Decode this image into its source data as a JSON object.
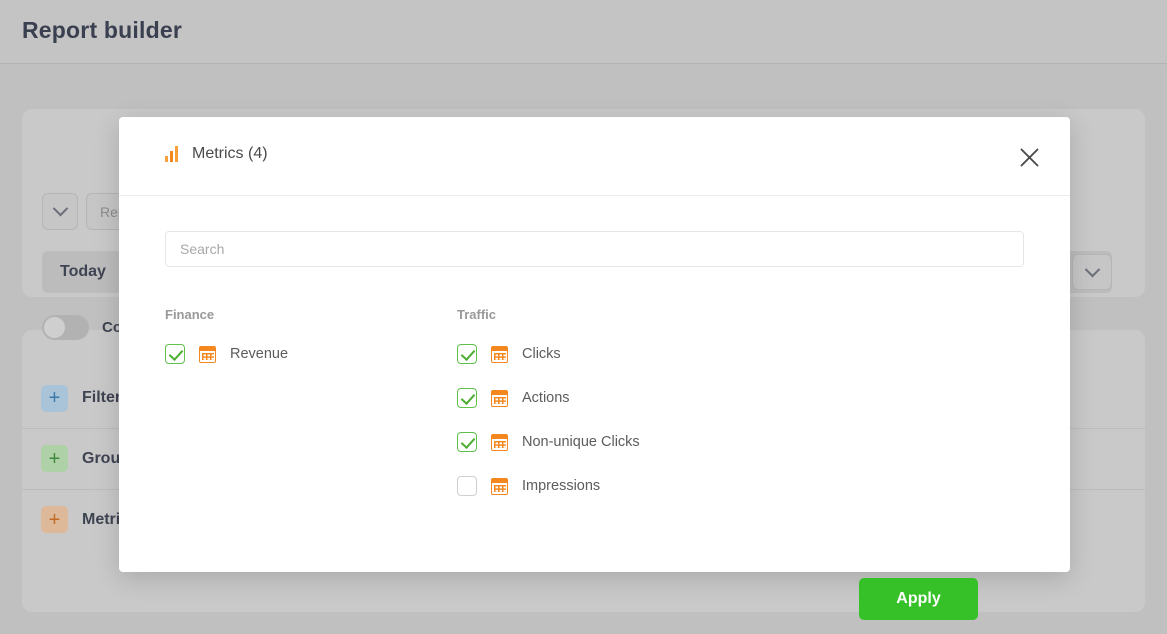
{
  "page": {
    "title": "Report builder"
  },
  "background": {
    "report_field_placeholder": "Report name",
    "date_range_label": "Today",
    "compare_toggle_label": "Compare",
    "chevron_icon": "chevron-down-icon",
    "builder_rows": [
      {
        "label": "Filters",
        "plus_icon": "plus-icon",
        "color": "#3a7aa8"
      },
      {
        "label": "Groupings",
        "plus_icon": "plus-icon",
        "color": "#3e8a3b"
      },
      {
        "label": "Metrics",
        "plus_icon": "plus-icon",
        "color": "#c06a24"
      }
    ],
    "plus_glyph": "+"
  },
  "modal": {
    "title": "Metrics (4)",
    "title_icon": "bar-chart-icon",
    "close_icon": "close-icon",
    "search": {
      "placeholder": "Search",
      "value": ""
    },
    "columns": [
      {
        "title": "Finance",
        "items": [
          {
            "label": "Revenue",
            "checked": true,
            "icon": "calendar-icon"
          }
        ]
      },
      {
        "title": "Traffic",
        "items": [
          {
            "label": "Clicks",
            "checked": true,
            "icon": "calendar-icon"
          },
          {
            "label": "Actions",
            "checked": true,
            "icon": "calendar-icon"
          },
          {
            "label": "Non-unique Clicks",
            "checked": true,
            "icon": "calendar-icon"
          },
          {
            "label": "Impressions",
            "checked": false,
            "icon": "calendar-icon"
          }
        ]
      }
    ],
    "apply_label": "Apply"
  },
  "colors": {
    "accent_orange": "#f5871f",
    "accent_green": "#35c127",
    "checkbox_green": "#4caf32",
    "title_text": "#3a4050"
  }
}
